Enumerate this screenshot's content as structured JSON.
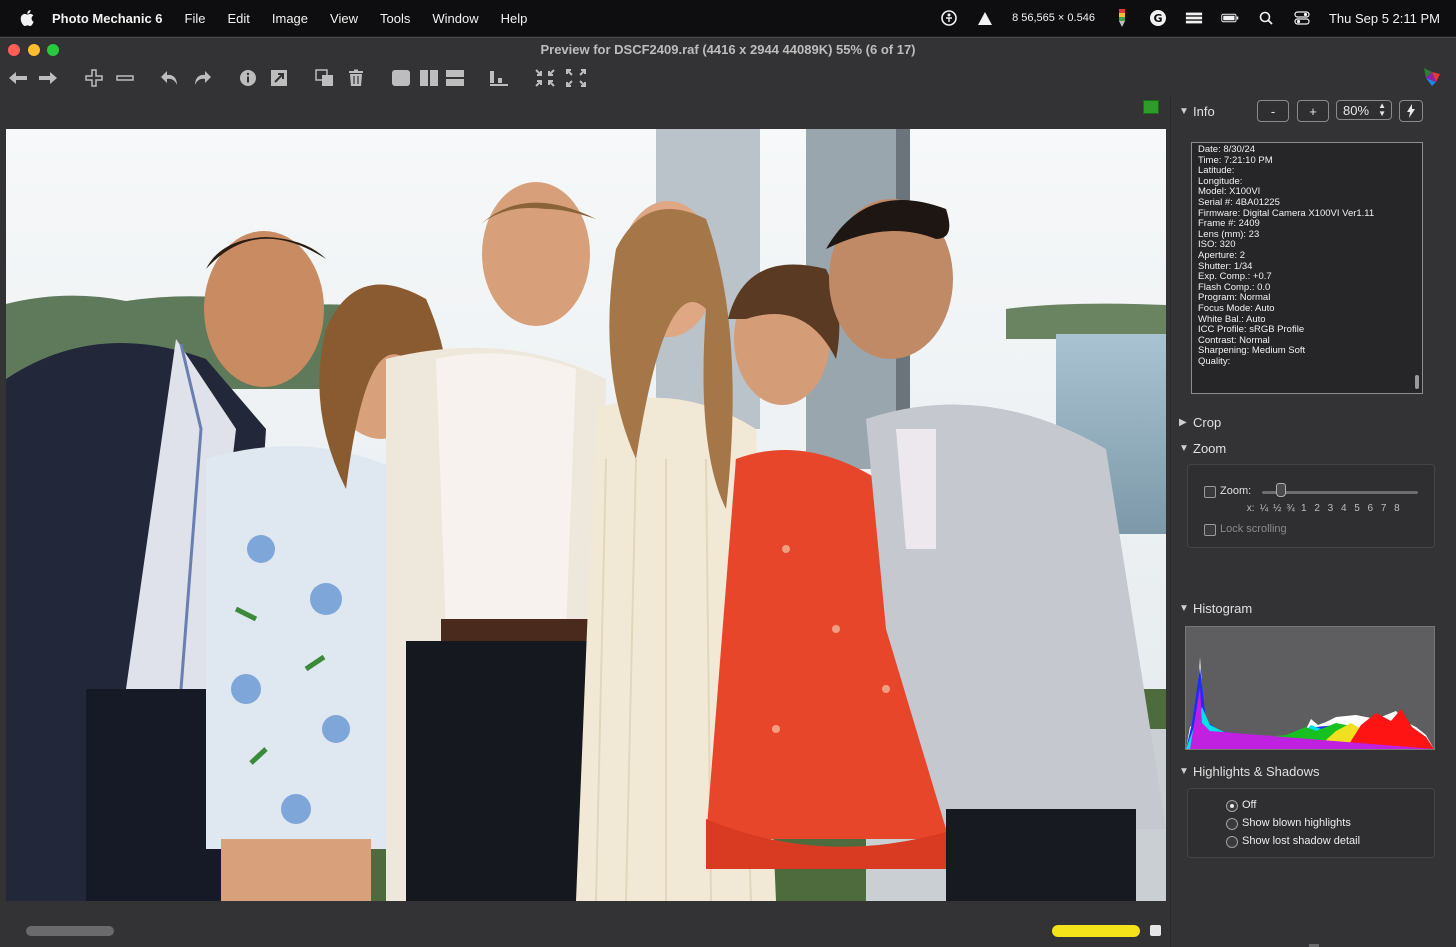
{
  "menubar": {
    "app_name": "Photo Mechanic 6",
    "items": [
      "File",
      "Edit",
      "Image",
      "View",
      "Tools",
      "Window",
      "Help"
    ],
    "coords": "8 56,565 × 0.546",
    "datetime": "Thu Sep 5  2:11 PM"
  },
  "window": {
    "title": "Preview for DSCF2409.raf (4416 x 2944 44089K) 55% (6 of 17)"
  },
  "info": {
    "header": "Info",
    "minus_label": "-",
    "plus_label": "+",
    "zoom_value": "80%",
    "lines": [
      "Date: 8/30/24",
      "Time: 7:21:10 PM",
      "Latitude:",
      "Longitude:",
      "Model: X100VI",
      "Serial #: 4BA01225",
      "Firmware: Digital Camera X100VI Ver1.11",
      "Frame #: 2409",
      "Lens (mm): 23",
      "ISO: 320",
      "Aperture: 2",
      "Shutter: 1/34",
      "Exp. Comp.: +0.7",
      "Flash Comp.: 0.0",
      "Program: Normal",
      "Focus Mode: Auto",
      "White Bal.: Auto",
      "ICC Profile: sRGB Profile",
      "Contrast: Normal",
      "Sharpening: Medium Soft",
      "Quality:"
    ]
  },
  "crop": {
    "header": "Crop"
  },
  "zoom": {
    "header": "Zoom",
    "label": "Zoom:",
    "scale_prefix": "x:",
    "scale": [
      "¼",
      "½",
      "¾",
      "1",
      "2",
      "3",
      "4",
      "5",
      "6",
      "7",
      "8"
    ],
    "lock_label": "Lock scrolling"
  },
  "histogram": {
    "header": "Histogram"
  },
  "highlights": {
    "header": "Highlights & Shadows",
    "options": [
      "Off",
      "Show blown highlights",
      "Show lost shadow detail"
    ],
    "selected": "Off"
  },
  "colors": {
    "label_tag": "#2f9b2a",
    "color_class_bar": "#f4e21a"
  }
}
